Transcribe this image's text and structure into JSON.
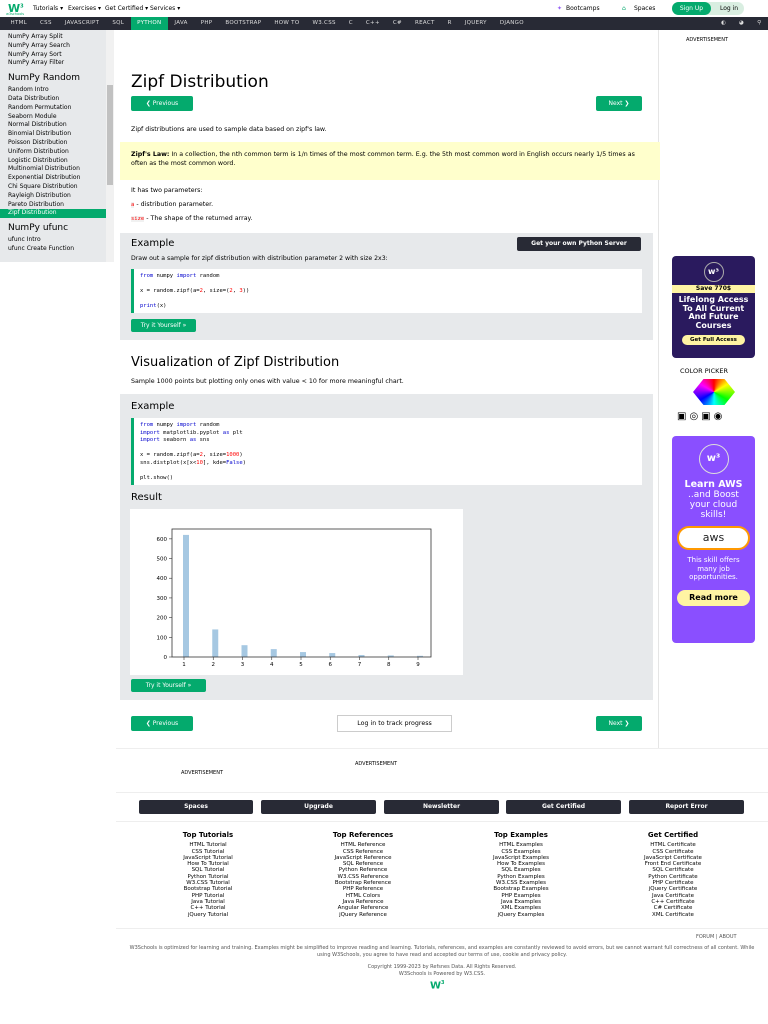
{
  "header": {
    "logo": "w3schools",
    "menus": [
      "Tutorials ▾",
      "Exercises ▾",
      "Get Certified ▾",
      "Services ▾"
    ],
    "bootcamps": "Bootcamps",
    "spaces": "Spaces",
    "signup": "Sign Up",
    "login": "Log in"
  },
  "nav": [
    "HTML",
    "CSS",
    "JAVASCRIPT",
    "SQL",
    "PYTHON",
    "JAVA",
    "PHP",
    "BOOTSTRAP",
    "HOW TO",
    "W3.CSS",
    "C",
    "C++",
    "C#",
    "REACT",
    "R",
    "JQUERY",
    "DJANGO"
  ],
  "sidebar": {
    "top_items": [
      "NumPy Array Split",
      "NumPy Array Search",
      "NumPy Array Sort",
      "NumPy Array Filter"
    ],
    "random_heading": "NumPy Random",
    "random_items": [
      "Random Intro",
      "Data Distribution",
      "Random Permutation",
      "Seaborn Module",
      "Normal Distribution",
      "Binomial Distribution",
      "Poisson Distribution",
      "Uniform Distribution",
      "Logistic Distribution",
      "Multinomial Distribution",
      "Exponential Distribution",
      "Chi Square Distribution",
      "Rayleigh Distribution",
      "Pareto Distribution",
      "Zipf Distribution"
    ],
    "ufunc_heading": "NumPy ufunc",
    "ufunc_items": [
      "ufunc Intro",
      "ufunc Create Function"
    ]
  },
  "main": {
    "title": "Zipf Distribution",
    "prev": "❮ Previous",
    "next": "Next ❯",
    "intro": "Zipf distributions are used to sample data based on zipf's law.",
    "note_bold": "Zipf's Law:",
    "note": " In a collection, the nth common term is 1/n times of the most common term. E.g. the 5th most common word in English occurs nearly 1/5 times as often as the most common word.",
    "params_intro": "It has two parameters:",
    "param_a": "a",
    "param_a_desc": " - distribution parameter.",
    "param_size": "size",
    "param_size_desc": " - The shape of the returned array.",
    "example1": {
      "heading": "Example",
      "server_btn": "Get your own Python Server",
      "desc": "Draw out a sample for zipf distribution with distribution parameter 2 with size 2x3:",
      "try": "Try it Yourself »"
    },
    "viz_title": "Visualization of Zipf Distribution",
    "viz_desc": "Sample 1000 points but plotting only ones with value < 10 for more meaningful chart.",
    "example2": {
      "heading": "Example",
      "result": "Result",
      "try": "Try it Yourself »"
    },
    "track": "Log in to track progress"
  },
  "right": {
    "advertisement": "ADVERTISEMENT",
    "ad1_save": "Save 770$",
    "ad1_text": "Lifelong Access To All Current And Future Courses",
    "ad1_btn": "Get Full Access",
    "color_picker": "COLOR PICKER",
    "ad2_title": "Learn AWS",
    "ad2_sub": "..and Boost your cloud skills!",
    "ad2_aws": "aws",
    "ad2_text": "This skill offers many job opportunities.",
    "ad2_btn": "Read more"
  },
  "ads": {
    "a1": "ADVERTISEMENT",
    "a2": "ADVERTISEMENT"
  },
  "footer_buttons": [
    "Spaces",
    "Upgrade",
    "Newsletter",
    "Get Certified",
    "Report Error"
  ],
  "footer_cols": [
    {
      "title": "Top Tutorials",
      "items": [
        "HTML Tutorial",
        "CSS Tutorial",
        "JavaScript Tutorial",
        "How To Tutorial",
        "SQL Tutorial",
        "Python Tutorial",
        "W3.CSS Tutorial",
        "Bootstrap Tutorial",
        "PHP Tutorial",
        "Java Tutorial",
        "C++ Tutorial",
        "jQuery Tutorial"
      ]
    },
    {
      "title": "Top References",
      "items": [
        "HTML Reference",
        "CSS Reference",
        "JavaScript Reference",
        "SQL Reference",
        "Python Reference",
        "W3.CSS Reference",
        "Bootstrap Reference",
        "PHP Reference",
        "HTML Colors",
        "Java Reference",
        "Angular Reference",
        "jQuery Reference"
      ]
    },
    {
      "title": "Top Examples",
      "items": [
        "HTML Examples",
        "CSS Examples",
        "JavaScript Examples",
        "How To Examples",
        "SQL Examples",
        "Python Examples",
        "W3.CSS Examples",
        "Bootstrap Examples",
        "PHP Examples",
        "Java Examples",
        "XML Examples",
        "jQuery Examples"
      ]
    },
    {
      "title": "Get Certified",
      "items": [
        "HTML Certificate",
        "CSS Certificate",
        "JavaScript Certificate",
        "Front End Certificate",
        "SQL Certificate",
        "Python Certificate",
        "PHP Certificate",
        "jQuery Certificate",
        "Java Certificate",
        "C++ Certificate",
        "C# Certificate",
        "XML Certificate"
      ]
    }
  ],
  "footer": {
    "forum_about": "FORUM | ABOUT",
    "disclaimer": "W3Schools is optimized for learning and training. Examples might be simplified to improve reading and learning. Tutorials, references, and examples are constantly reviewed to avoid errors, but we cannot warrant full correctness of all content. While using W3Schools, you agree to have read and accepted our terms of use, cookie and privacy policy.",
    "copyright": "Copyright 1999-2023 by Refsnes Data. All Rights Reserved.",
    "powered": "W3Schools is Powered by W3.CSS."
  },
  "chart_data": {
    "type": "bar",
    "categories": [
      "1",
      "2",
      "3",
      "4",
      "5",
      "6",
      "7",
      "8",
      "9"
    ],
    "values": [
      620,
      140,
      60,
      40,
      25,
      20,
      10,
      8,
      6
    ],
    "yticks": [
      "0",
      "100",
      "200",
      "300",
      "400",
      "500",
      "600"
    ],
    "ylim": [
      0,
      650
    ],
    "xlabel": "",
    "ylabel": "",
    "title": "",
    "color": "#A6C8E2"
  }
}
